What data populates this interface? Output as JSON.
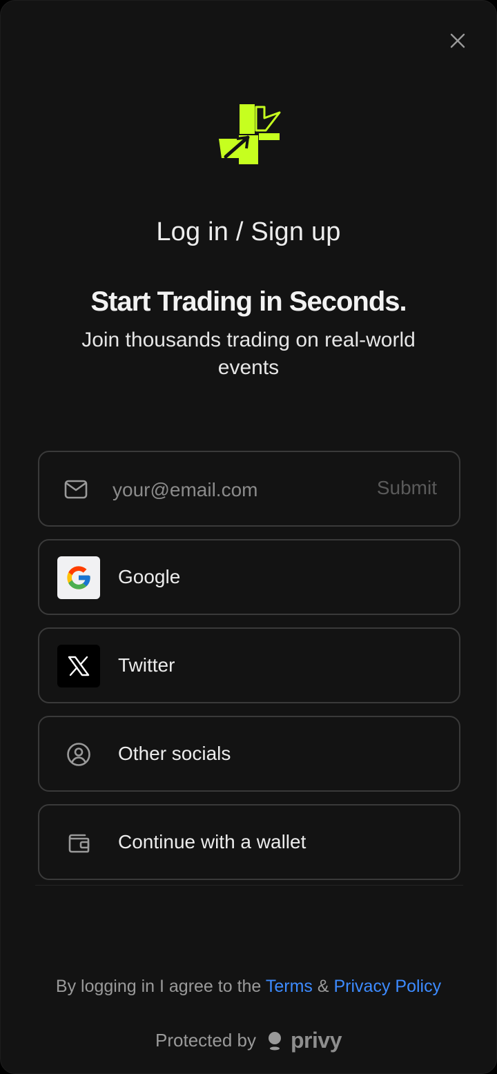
{
  "modal": {
    "close_icon": "close-icon",
    "title": "Log in / Sign up",
    "headline": "Start Trading in Seconds.",
    "subhead": "Join thousands trading on real-world events",
    "brand_color": "#c6ff1f"
  },
  "email": {
    "icon": "mail-icon",
    "placeholder": "your@email.com",
    "value": "",
    "submit_label": "Submit"
  },
  "options": [
    {
      "label": "Google",
      "icon": "google-icon"
    },
    {
      "label": "Twitter",
      "icon": "x-icon"
    },
    {
      "label": "Other socials",
      "icon": "user-circle-icon"
    },
    {
      "label": "Continue with a wallet",
      "icon": "wallet-icon"
    }
  ],
  "footer": {
    "legal_prefix": "By logging in I agree to the",
    "terms_label": "Terms",
    "amp": "&",
    "privacy_label": "Privacy Policy",
    "protected_by": "Protected by",
    "privy_word": "privy",
    "link_color": "#3d8bff"
  }
}
